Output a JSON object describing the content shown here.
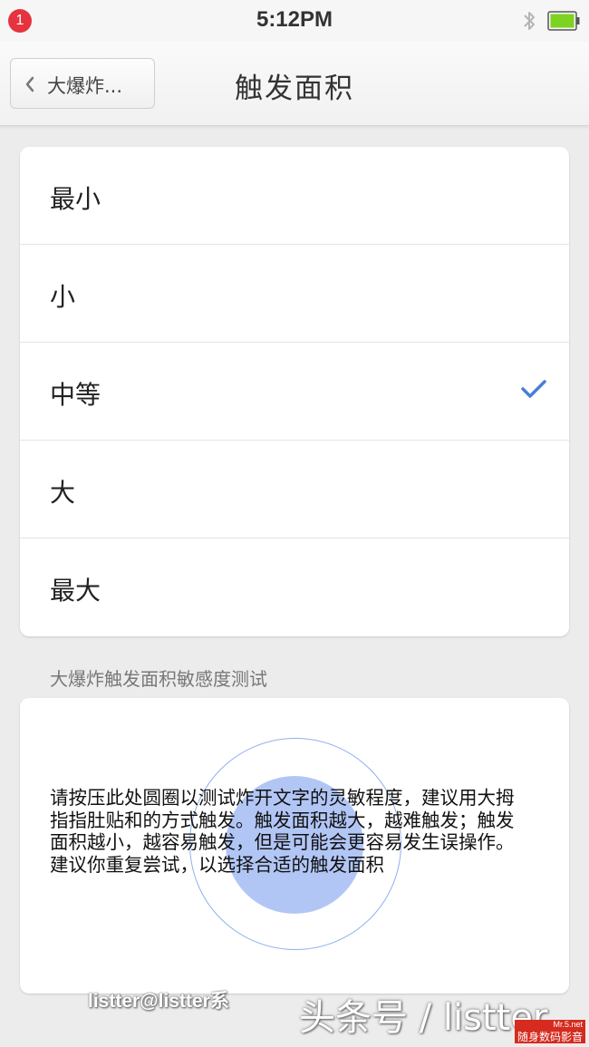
{
  "status_bar": {
    "notification_count": "1",
    "time": "5:12PM",
    "icons": [
      "bluetooth-icon",
      "battery-icon"
    ]
  },
  "nav": {
    "back_label": "大爆炸...",
    "title": "触发面积"
  },
  "options": [
    {
      "label": "最小",
      "selected": false
    },
    {
      "label": "小",
      "selected": false
    },
    {
      "label": "中等",
      "selected": true
    },
    {
      "label": "大",
      "selected": false
    },
    {
      "label": "最大",
      "selected": false
    }
  ],
  "test": {
    "section_label": "大爆炸触发面积敏感度测试",
    "instructions": "请按压此处圆圈以测试炸开文字的灵敏程度，建议用大拇指指肚贴和的方式触发。触发面积越大，越难触发；触发面积越小，越容易触发，但是可能会更容易发生误操作。建议你重复尝试，以选择合适的触发面积"
  },
  "watermarks": {
    "handle": "listter@listter系",
    "toutiao": "头条号 / listter",
    "logo_top": "Mr.5.net",
    "logo_bottom": "随身数码影音"
  },
  "colors": {
    "accent": "#4a7fd9",
    "badge": "#e5333f",
    "battery": "#7ed321"
  }
}
